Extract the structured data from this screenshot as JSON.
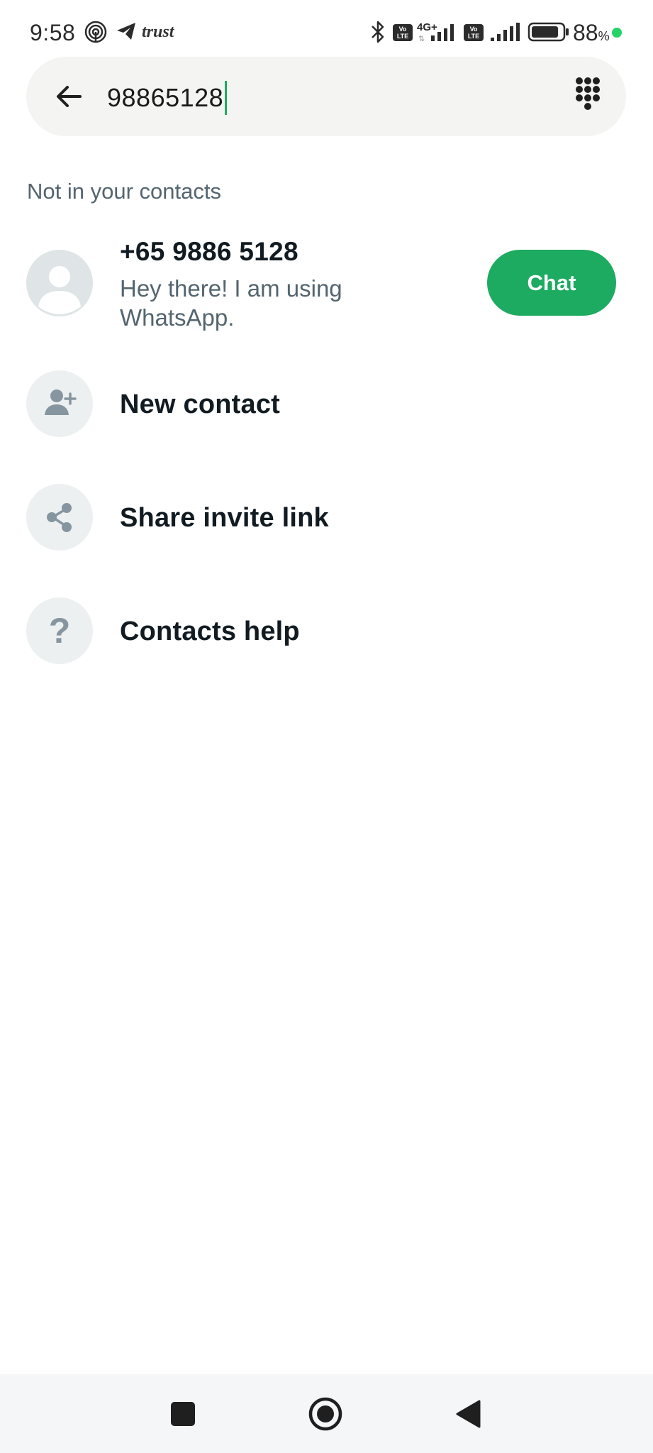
{
  "status_bar": {
    "time": "9:58",
    "carrier_text": "trust",
    "network_type": "4G+",
    "volte_label": "Vo LTE",
    "battery_text": "88",
    "battery_percent_sign": "%",
    "battery_level": 0.88,
    "dot_color": "#25d366",
    "icons": [
      "hotspot-icon",
      "telegram-icon",
      "bluetooth-icon",
      "volte-icon",
      "signal-icon",
      "battery-icon"
    ]
  },
  "search": {
    "value": "98865128",
    "caret_color": "#1daa61",
    "back_icon": "arrow-left-icon",
    "dialpad_icon": "dialpad-icon"
  },
  "section": {
    "title": "Not in your contacts"
  },
  "contact": {
    "name": "+65 9886 5128",
    "status": "Hey there! I am using WhatsApp.",
    "chat_label": "Chat",
    "chat_color": "#1daa61"
  },
  "actions": [
    {
      "label": "New contact",
      "icon": "add-person-icon"
    },
    {
      "label": "Share invite link",
      "icon": "share-icon"
    },
    {
      "label": "Contacts help",
      "icon": "help-icon",
      "glyph": "?"
    }
  ],
  "nav_bar": {
    "buttons": [
      "recents-button",
      "home-button",
      "back-button"
    ]
  }
}
